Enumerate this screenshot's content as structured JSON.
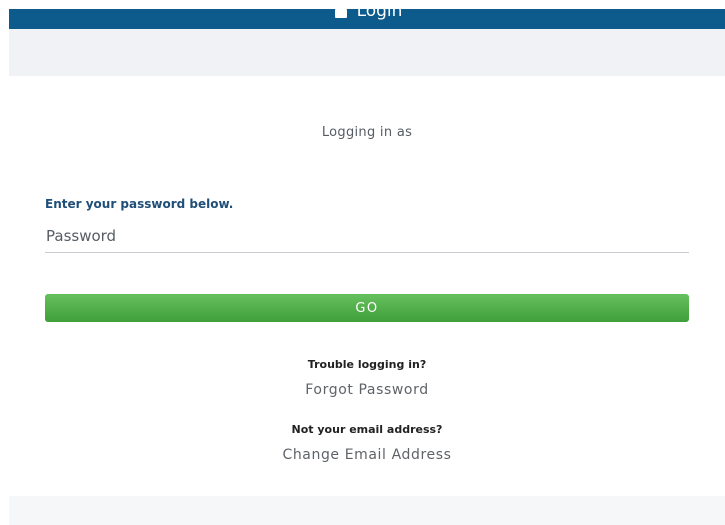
{
  "header": {
    "title": "Login",
    "icon": "lock-icon",
    "background_color": "#0d5a8c"
  },
  "account": {
    "logging_in_as_label": "Logging in as",
    "email_value": ""
  },
  "password_form": {
    "prompt": "Enter your password below.",
    "password_placeholder": "Password",
    "password_value": "",
    "submit_label": "GO",
    "submit_color": "#4caf50"
  },
  "help": {
    "trouble_label": "Trouble logging in?",
    "forgot_password_link": "Forgot Password",
    "not_your_email_label": "Not your email address?",
    "change_email_link": "Change Email Address"
  }
}
